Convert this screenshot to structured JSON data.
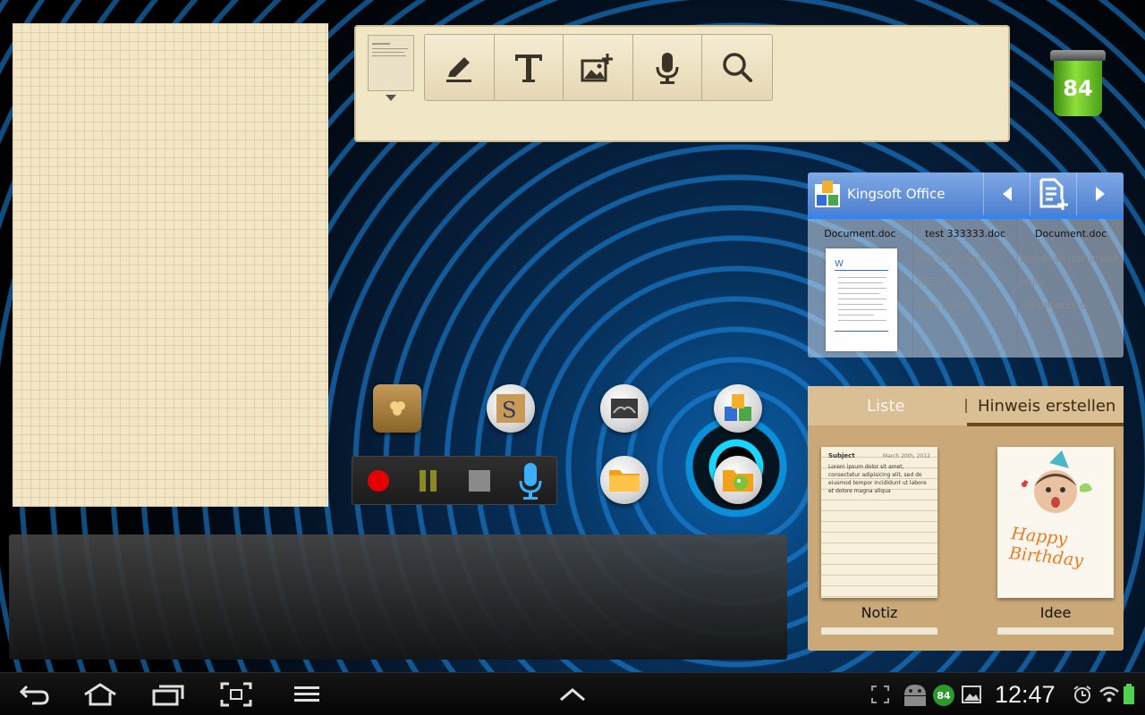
{
  "snote_toolbar": {
    "tools": [
      "pen-icon",
      "text-icon",
      "image-icon",
      "mic-icon",
      "search-icon"
    ]
  },
  "battery_widget": {
    "level": "84"
  },
  "kingsoft": {
    "title": "Kingsoft Office",
    "documents": [
      {
        "name": "Document.doc",
        "lines": []
      },
      {
        "name": "test 333333.doc",
        "lines": [
          "Test document 333333",
          "hallo hallo"
        ]
      },
      {
        "name": "Document.doc",
        "lines": [
          "test likan document",
          "hallo",
          "halloooooooo"
        ]
      }
    ]
  },
  "memo": {
    "tab_list": "Liste",
    "tab_create": "Hinweis erstellen",
    "cards": [
      {
        "label": "Notiz",
        "subject": "Subject",
        "date": "March 20th, 2012",
        "text": "Lorem ipsum dolor sit amet, consectetur adipisicing elit, sed do eiusmod tempor incididunt ut labore et dolore magna aliqua"
      },
      {
        "label": "Idee",
        "text": "Happy Birthday"
      }
    ]
  },
  "status_bar": {
    "time": "12:47",
    "battery_badge": "84"
  },
  "colors": {
    "accent_blue": "#2c86ff",
    "memo_brown": "#caa877",
    "paper": "#f3e6c5"
  }
}
